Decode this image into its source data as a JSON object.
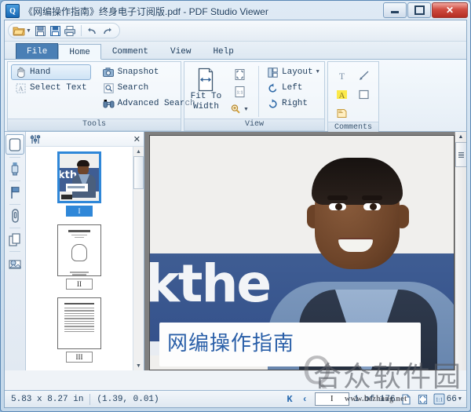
{
  "window": {
    "title": "《网编操作指南》终身电子订阅版.pdf - PDF Studio Viewer",
    "app_icon": "Q",
    "controls": {
      "minimize": "minimize-icon",
      "maximize": "maximize-icon",
      "close": "✕"
    }
  },
  "quick_access": {
    "items": [
      {
        "name": "open-file",
        "icon": "📂"
      },
      {
        "name": "open-dropdown",
        "icon": "▼"
      },
      {
        "name": "save",
        "icon": "💾"
      },
      {
        "name": "save-as",
        "icon": "💾"
      },
      {
        "name": "print",
        "icon": "🖨"
      },
      {
        "name": "undo",
        "icon": "↶"
      },
      {
        "name": "redo",
        "icon": "↷"
      }
    ]
  },
  "tabs": [
    {
      "label": "File",
      "state": "file"
    },
    {
      "label": "Home",
      "state": "active"
    },
    {
      "label": "Comment",
      "state": "normal"
    },
    {
      "label": "View",
      "state": "normal"
    },
    {
      "label": "Help",
      "state": "normal"
    }
  ],
  "ribbon": {
    "tools": {
      "title": "Tools",
      "hand": "Hand",
      "select_text": "Select Text",
      "snapshot": "Snapshot",
      "search": "Search",
      "advanced_search": "Advanced Search"
    },
    "view": {
      "title": "View",
      "fit_to_width_line1": "Fit To",
      "fit_to_width_line2": "Width",
      "layout": "Layout",
      "left": "Left",
      "right": "Right"
    },
    "comments": {
      "title": "Comments",
      "items": [
        "text-comment",
        "arrow-comment",
        "highlight-comment",
        "rectangle-comment",
        "sticky-note-comment"
      ]
    }
  },
  "sidebar": {
    "items": [
      {
        "name": "pages-panel",
        "selected": true
      },
      {
        "name": "signature-panel",
        "selected": false
      },
      {
        "name": "bookmarks-panel",
        "selected": false
      },
      {
        "name": "attachments-panel",
        "selected": false
      },
      {
        "name": "layers-panel",
        "selected": false
      },
      {
        "name": "stamps-panel",
        "selected": false
      }
    ]
  },
  "thumbnail_panel": {
    "settings_icon": "sliders-icon",
    "close_icon": "✕",
    "thumbnails": [
      {
        "label": "I",
        "selected": true
      },
      {
        "label": "II",
        "selected": false
      },
      {
        "label": "III",
        "selected": false
      }
    ]
  },
  "page": {
    "background_text": "kthe",
    "banner_title": "网编操作指南"
  },
  "status_bar": {
    "page_size": "5.83 x 8.27 in",
    "cursor_position": "(1.39,  0.01)",
    "first_page_icon": "K",
    "prev_page_icon": "‹",
    "page_field_value": "I",
    "page_count_label": "1 of 176",
    "zoom_value": "66",
    "zoom_caret": "▼"
  },
  "watermark": {
    "big": "Q",
    "text": "合众软件园",
    "url": "www.hezhong.net"
  },
  "colors": {
    "accent": "#2a6bb0",
    "file_tab": "#4a7fb5",
    "selection": "#2f87d8",
    "close_button": "#b42d22",
    "banner_text": "#2a5fa8"
  }
}
